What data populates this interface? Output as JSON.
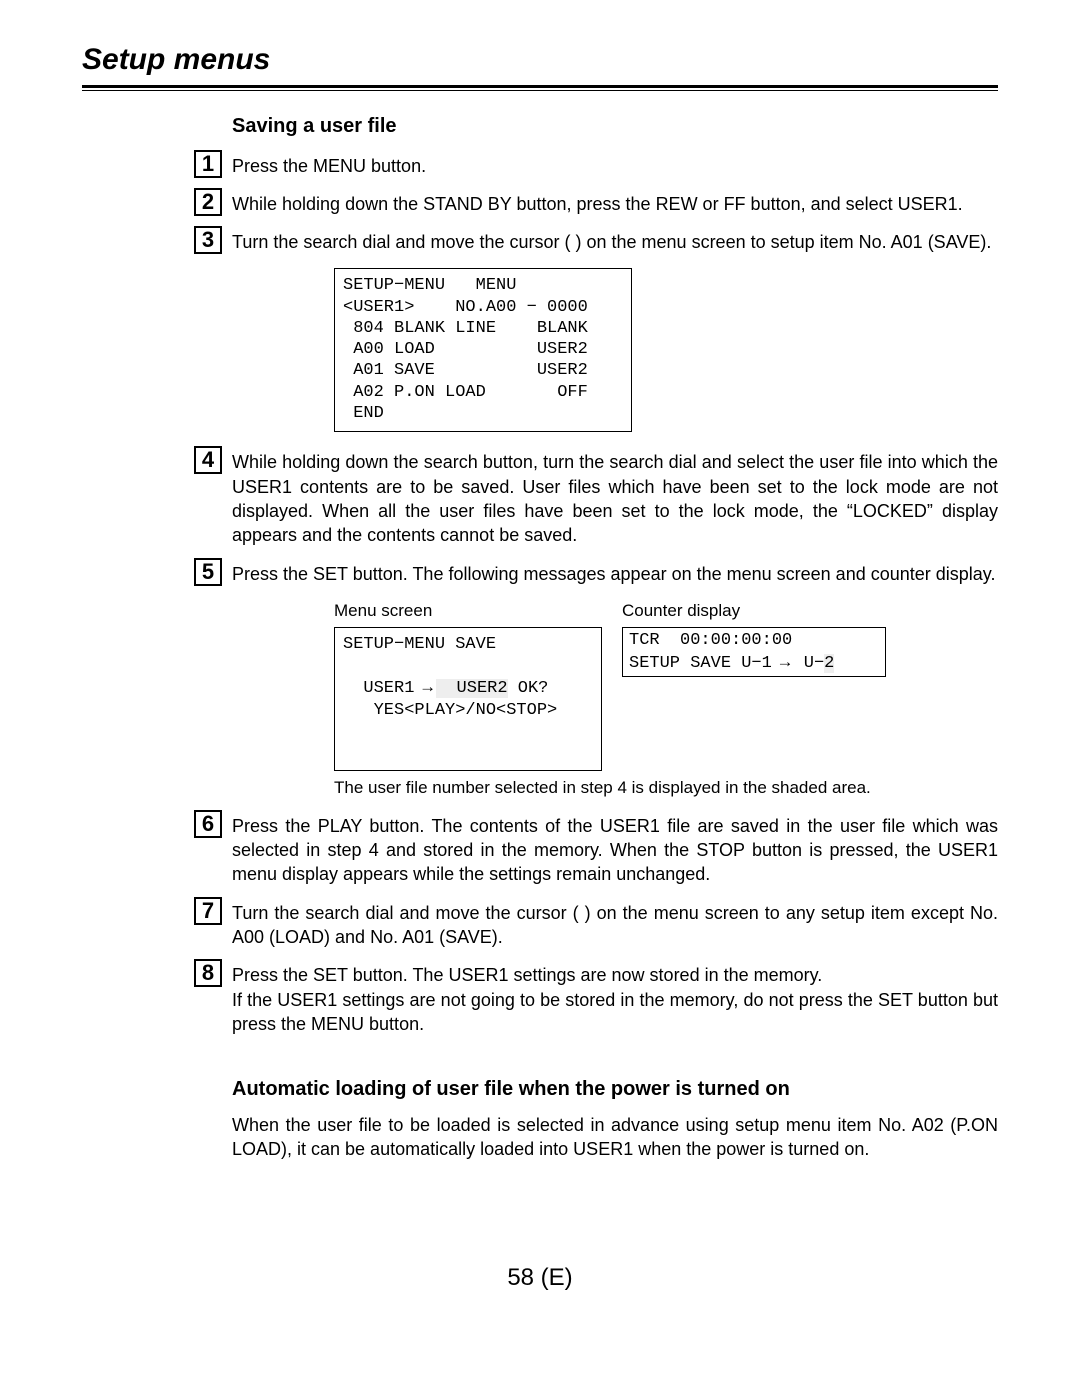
{
  "page": {
    "title": "Setup menus",
    "number": "58 (E)"
  },
  "section1": {
    "title": "Saving a user file",
    "steps": {
      "n1": "1",
      "t1": "Press the MENU button.",
      "n2": "2",
      "t2": "While holding down the STAND BY button, press the REW or FF button, and select USER1.",
      "n3": "3",
      "t3": "Turn the search dial and move the cursor (    ) on the menu screen to setup item No. A01 (SAVE).",
      "n4": "4",
      "t4": "While holding down the search button, turn the search dial and select the user file into which the USER1 contents are to be saved. User files which have been set to the lock mode are not displayed. When all the user files have been set to the lock mode, the “LOCKED” display appears and the contents cannot be saved.",
      "n5": "5",
      "t5": "Press the SET button. The following messages appear on the menu screen and counter display.",
      "n6": "6",
      "t6": "Press the PLAY button. The contents of the USER1 file are saved in the user file which was selected in step 4 and stored in the memory. When the STOP button is pressed, the USER1 menu display appears while the settings remain unchanged.",
      "n7": "7",
      "t7": "Turn the search dial and move the cursor (    ) on the menu screen to any setup item except No. A00 (LOAD) and No. A01 (SAVE).",
      "n8": "8",
      "t8a": "Press the SET button. The USER1 settings are now stored in the memory.",
      "t8b": "If the USER1 settings are not going to be stored in the memory, do not press the SET button but press the MENU button."
    },
    "screen1": "SETUP−MENU   MENU\n<USER1>    NO.A00 − 0000\n 804 BLANK LINE    BLANK\n A00 LOAD          USER2\n A01 SAVE          USER2\n A02 P.ON LOAD       OFF\n END",
    "menuLabel": "Menu screen",
    "counterLabel": "Counter display",
    "screen2a": "SETUP−MENU SAVE",
    "screen2b_pre": "  USER1",
    "screen2b_user2": "  USER2",
    "screen2b_ok": " OK?",
    "screen2c": "   YES<PLAY>/NO<STOP>",
    "counter1": "TCR  00:00:00:00",
    "counter2a": "SETUP SAVE U−1",
    "counter2b": " U−",
    "counter2c": "2",
    "caption": "The user file number selected in step 4 is displayed in the shaded area."
  },
  "section2": {
    "title": "Automatic loading of user file when the power is turned on",
    "para": "When the user file to be loaded is selected in advance using setup menu item No. A02 (P.ON LOAD), it can be automatically loaded into USER1 when the power is turned on."
  }
}
